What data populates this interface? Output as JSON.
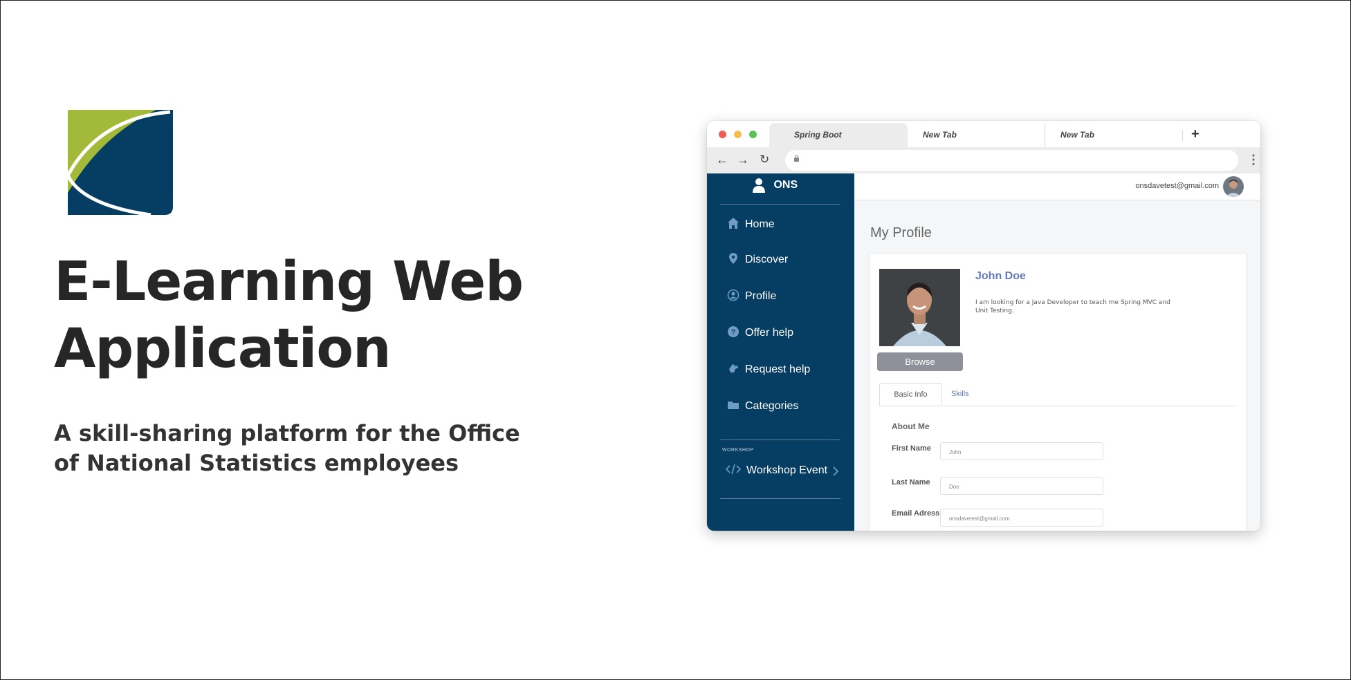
{
  "hero": {
    "title": "E-Learning Web Application",
    "subtitle": "A skill-sharing platform for the Office of National Statistics employees"
  },
  "colors": {
    "logo_green": "#a3b93a",
    "logo_navy": "#063d63",
    "sidebar_bg": "#063d63",
    "accent_link": "#6778b8",
    "browse_btn": "#8e919a"
  },
  "browser": {
    "tabs": [
      {
        "label": "Spring Boot",
        "active": true
      },
      {
        "label": "New Tab",
        "active": false
      },
      {
        "label": "New Tab",
        "active": false
      }
    ],
    "new_tab_glyph": "+",
    "back_glyph": "←",
    "forward_glyph": "→",
    "reload_glyph": "↻",
    "menu_glyph": "⋮"
  },
  "app": {
    "brand": "ONS",
    "nav": [
      {
        "label": "Home",
        "icon": "home-icon"
      },
      {
        "label": "Discover",
        "icon": "map-pin-icon"
      },
      {
        "label": "Profile",
        "icon": "user-circle-icon"
      },
      {
        "label": "Offer help",
        "icon": "question-circle-icon"
      },
      {
        "label": "Request help",
        "icon": "hand-icon"
      },
      {
        "label": "Categories",
        "icon": "folder-icon"
      }
    ],
    "section_label": "WORKSHOP",
    "workshop": {
      "label": "Workshop Event",
      "icon": "code-icon"
    },
    "user_email": "onsdavetest@gmail.com",
    "page_title": "My Profile",
    "profile": {
      "name": "John Doe",
      "bio": "I am looking for a Java Developer to teach me Spring MVC and Unit Testing.",
      "browse_label": "Browse",
      "tabs": [
        "Basic Info",
        "Skills"
      ],
      "section_title": "About Me",
      "fields": [
        {
          "label": "First Name",
          "value": "John"
        },
        {
          "label": "Last Name",
          "value": "Doe"
        },
        {
          "label": "Email Adress",
          "value": "onsdavetest@gmail.com"
        }
      ]
    }
  }
}
